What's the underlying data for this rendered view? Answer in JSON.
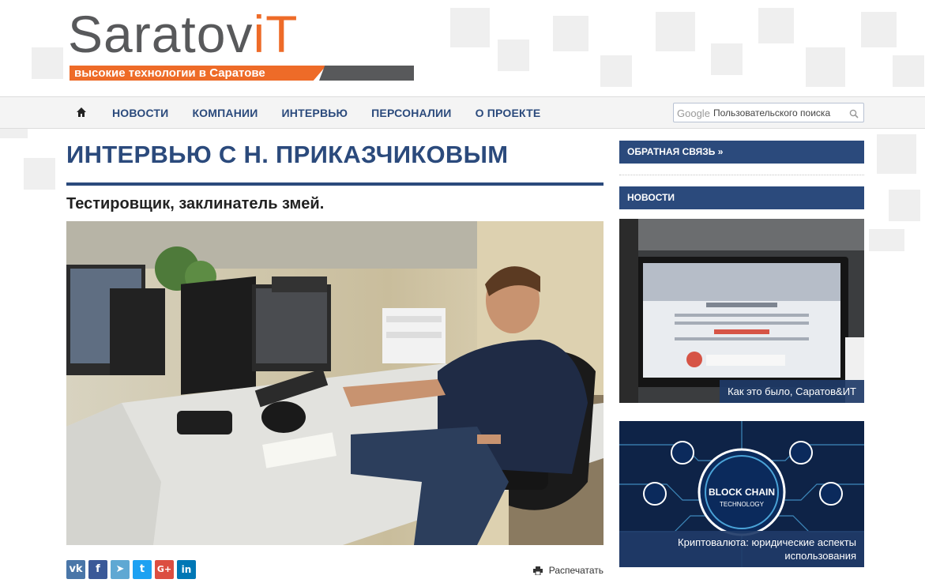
{
  "site": {
    "logo_main": "Saratov",
    "logo_accent": "iT",
    "logo_tagline": "высокие технологии в Саратове"
  },
  "nav": {
    "items": [
      {
        "label": "НОВОСТИ"
      },
      {
        "label": "КОМПАНИИ"
      },
      {
        "label": "ИНТЕРВЬЮ"
      },
      {
        "label": "ПЕРСОНАЛИИ"
      },
      {
        "label": "О ПРОЕКТЕ"
      }
    ],
    "search_brand": "Google",
    "search_placeholder": "Пользовательского поиска"
  },
  "article": {
    "title": "ИНТЕРВЬЮ С Н. ПРИКАЗЧИКОВЫМ",
    "subtitle": "Тестировщик, заклинатель змей.",
    "print_label": "Распечатать"
  },
  "share": [
    {
      "icon": "vk-icon",
      "glyph": "vk",
      "color": "#4a76a8"
    },
    {
      "icon": "facebook-icon",
      "glyph": "f",
      "color": "#3b5998"
    },
    {
      "icon": "telegram-icon",
      "glyph": "➤",
      "color": "#5fa8d3"
    },
    {
      "icon": "twitter-icon",
      "glyph": "t",
      "color": "#1da1f2"
    },
    {
      "icon": "google-plus-icon",
      "glyph": "G+",
      "color": "#dc4e41"
    },
    {
      "icon": "linkedin-icon",
      "glyph": "in",
      "color": "#0077b5"
    }
  ],
  "sidebar": {
    "feedback_label": "ОБРАТНАЯ СВЯЗЬ »",
    "news_label": "НОВОСТИ",
    "news": [
      {
        "caption": "Как это было, Саратов&ИТ"
      },
      {
        "caption": "Криптовалюта: юридические аспекты использования",
        "badge_line1": "BLOCK CHAIN",
        "badge_line2": "TECHNOLOGY"
      }
    ]
  },
  "colors": {
    "brand_blue": "#2b4a7c",
    "brand_orange": "#ee6b28",
    "logo_gray": "#58595b"
  }
}
